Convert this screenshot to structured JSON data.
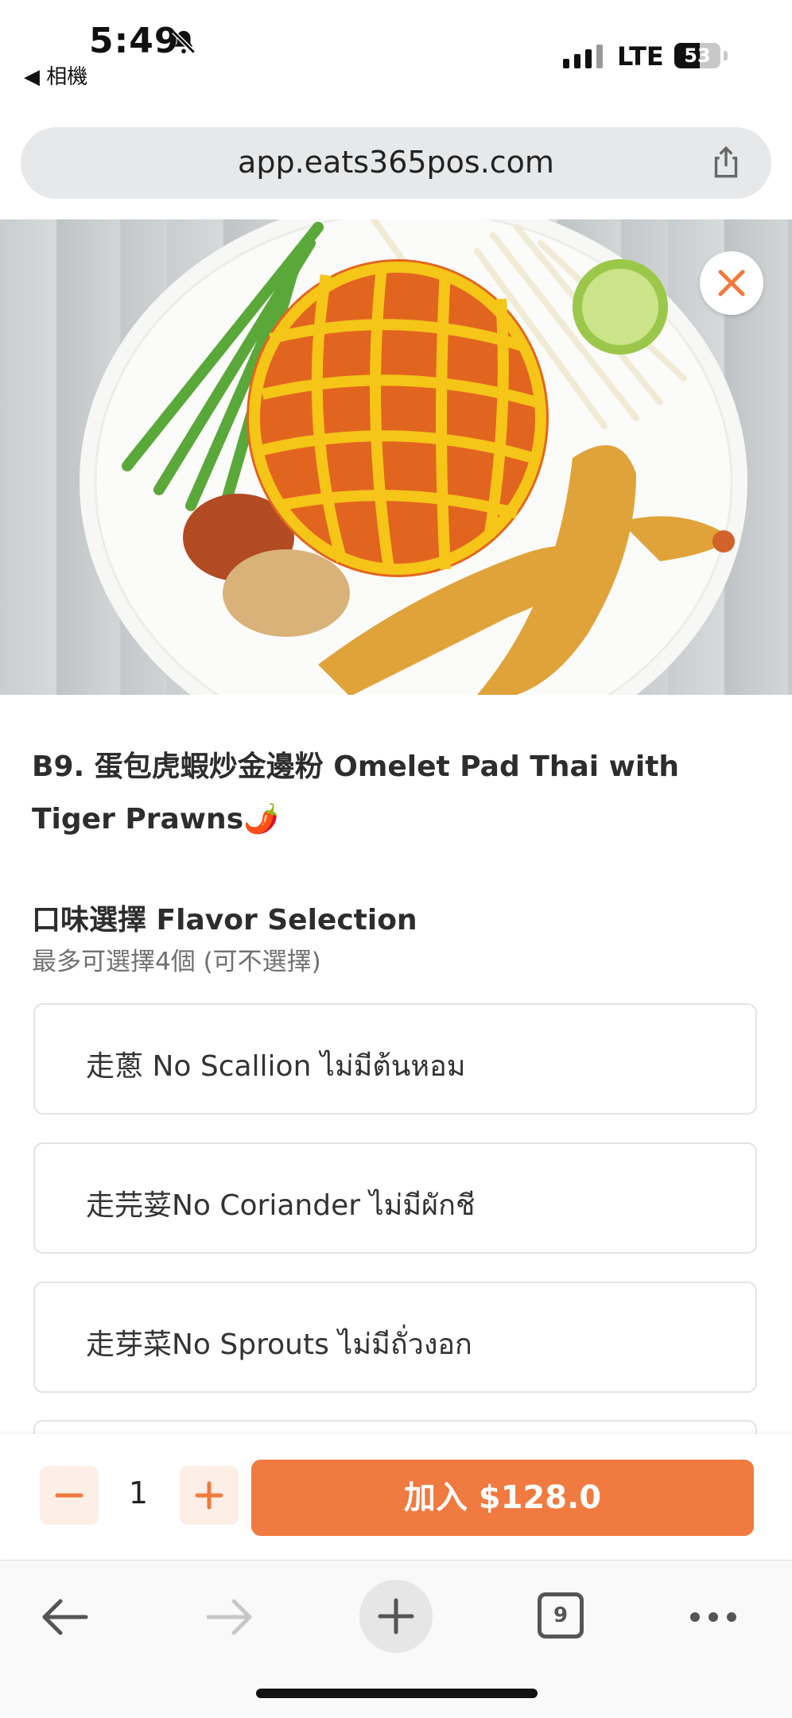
{
  "status_bar": {
    "time": "5:49",
    "back_app": "◀ 相機",
    "network": "LTE",
    "battery": "53"
  },
  "browser": {
    "url": "app.eats365pos.com",
    "tab_count": "9"
  },
  "item": {
    "title": "B9. 蛋包虎蝦炒金邊粉 Omelet Pad Thai with Tiger Prawns🌶️",
    "image_alt": "Omelet Pad Thai with Tiger Prawns"
  },
  "modifier_group": {
    "title": "口味選擇 Flavor Selection",
    "subtitle": "最多可選擇4個 (可不選擇)",
    "options": [
      {
        "label": "走蔥 No Scallion ไม่มีต้นหอม"
      },
      {
        "label": "走芫荽No Coriander ไม่มีผักชี"
      },
      {
        "label": "走芽菜No Sprouts ไม่มีถั่วงอก"
      }
    ]
  },
  "order": {
    "quantity": "1",
    "minus": "−",
    "plus": "+",
    "add_label": "加入 $128.0"
  },
  "colors": {
    "accent": "#f07a3f",
    "accent_light": "#fdeee6",
    "border": "#e3e3e3"
  }
}
